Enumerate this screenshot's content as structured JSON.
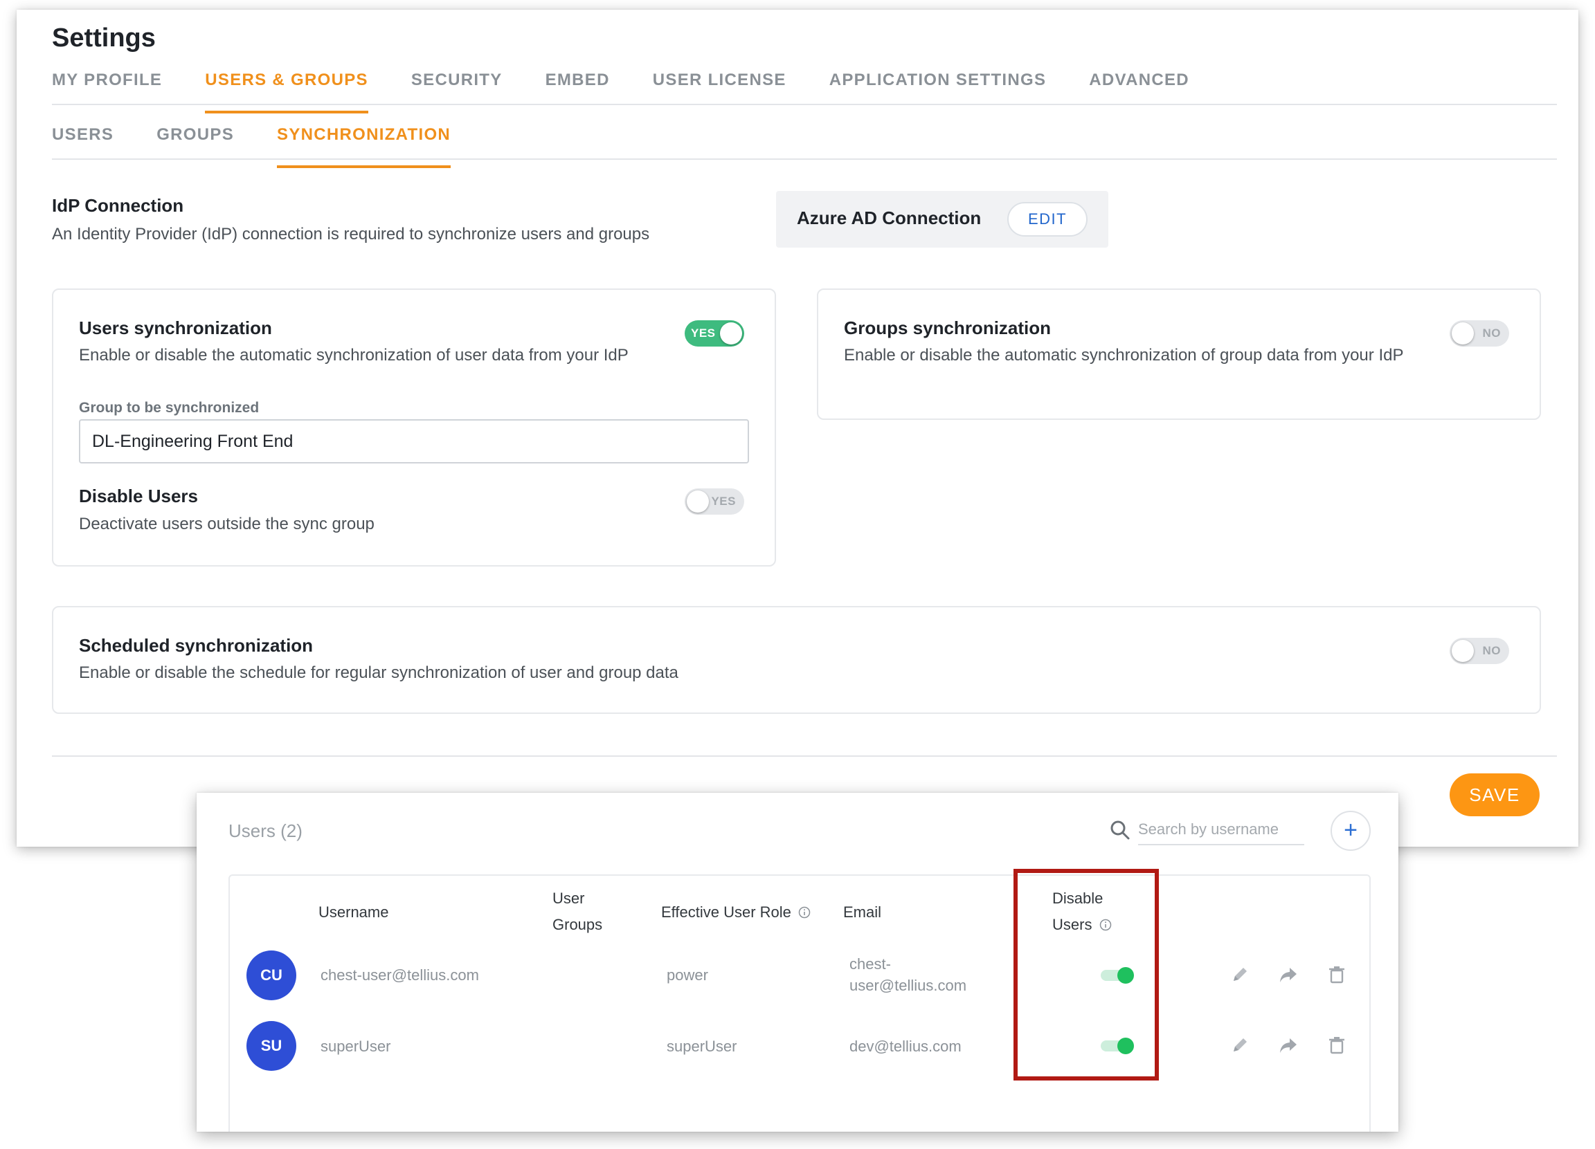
{
  "settings": {
    "title": "Settings",
    "main_tabs": [
      {
        "label": "MY PROFILE",
        "active": false
      },
      {
        "label": "USERS & GROUPS",
        "active": true
      },
      {
        "label": "SECURITY",
        "active": false
      },
      {
        "label": "EMBED",
        "active": false
      },
      {
        "label": "USER LICENSE",
        "active": false
      },
      {
        "label": "APPLICATION SETTINGS",
        "active": false
      },
      {
        "label": "ADVANCED",
        "active": false
      }
    ],
    "sub_tabs": [
      {
        "label": "USERS",
        "active": false
      },
      {
        "label": "GROUPS",
        "active": false
      },
      {
        "label": "SYNCHRONIZATION",
        "active": true
      }
    ],
    "idp": {
      "title": "IdP Connection",
      "description": "An Identity Provider (IdP) connection is required to synchronize users and groups",
      "connection_label": "Azure AD Connection",
      "edit_label": "EDIT"
    },
    "users_sync": {
      "title": "Users synchronization",
      "description": "Enable or disable the automatic synchronization of user data from your IdP",
      "toggle_label": "YES",
      "toggle_on": true,
      "group_label": "Group to be synchronized",
      "group_value": "DL-Engineering Front End",
      "disable_users_title": "Disable Users",
      "disable_users_description": "Deactivate users outside the sync group",
      "disable_users_toggle_label": "YES",
      "disable_users_toggle_on": false
    },
    "groups_sync": {
      "title": "Groups synchronization",
      "description": "Enable or disable the automatic synchronization of group data from your IdP",
      "toggle_label": "NO",
      "toggle_on": false
    },
    "scheduled_sync": {
      "title": "Scheduled synchronization",
      "description": "Enable or disable the schedule for regular synchronization of user and group data",
      "toggle_label": "NO",
      "toggle_on": false
    },
    "save_label": "SAVE",
    "accent_color": "#f0901c",
    "toggle_on_color": "#3ebb7f"
  },
  "users_panel": {
    "title": "Users (2)",
    "search_placeholder": "Search by username",
    "add_icon": "plus-icon",
    "columns": {
      "username": "Username",
      "user_groups_1": "User",
      "user_groups_2": "Groups",
      "role": "Effective User Role",
      "email": "Email",
      "disable_users_1": "Disable",
      "disable_users_2": "Users"
    },
    "rows": [
      {
        "initials": "CU",
        "username": "chest-user@tellius.com",
        "groups": "",
        "role": "power",
        "email_1": "chest-",
        "email_2": "user@tellius.com",
        "disable_on": true
      },
      {
        "initials": "SU",
        "username": "superUser",
        "groups": "",
        "role": "superUser",
        "email_1": "dev@tellius.com",
        "email_2": "",
        "disable_on": true
      }
    ],
    "row_actions": [
      "edit-icon",
      "share-icon",
      "delete-icon"
    ],
    "highlight_color": "#b11a14",
    "avatar_color": "#2e4ed6"
  }
}
